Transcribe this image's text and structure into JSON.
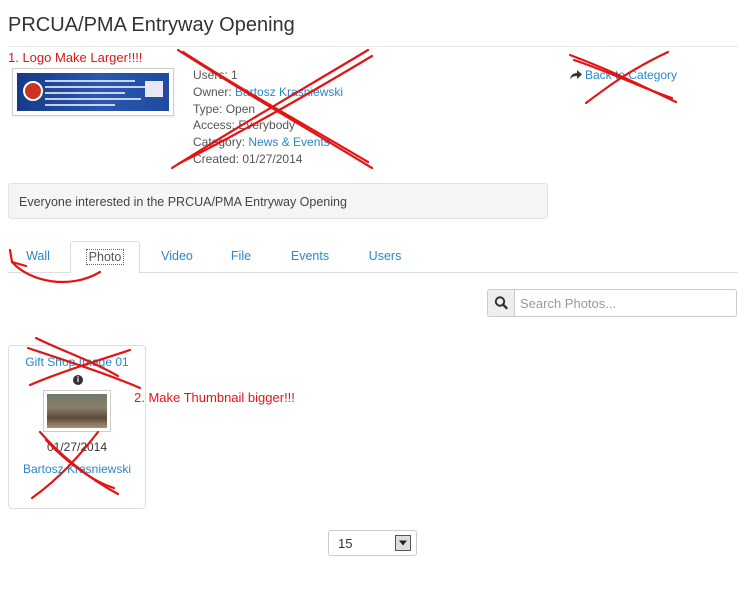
{
  "page": {
    "title": "PRCUA/PMA Entryway Opening"
  },
  "group": {
    "meta": [
      {
        "label": "Users:",
        "value": "1",
        "link": false
      },
      {
        "label": "Owner:",
        "value": "Bartosz Krasniewski",
        "link": true
      },
      {
        "label": "Type:",
        "value": "Open",
        "link": false
      },
      {
        "label": "Access:",
        "value": "Everybody",
        "link": false
      },
      {
        "label": "Category:",
        "value": "News & Events",
        "link": true
      },
      {
        "label": "Created:",
        "value": "01/27/2014",
        "link": false
      }
    ],
    "back_link": "Back to Category",
    "back_icon": "share-arrow-icon",
    "description": "Everyone interested in the PRCUA/PMA Entryway Opening"
  },
  "tabs": [
    {
      "label": "Wall",
      "active": false
    },
    {
      "label": "Photo",
      "active": true
    },
    {
      "label": "Video",
      "active": false
    },
    {
      "label": "File",
      "active": false
    },
    {
      "label": "Events",
      "active": false
    },
    {
      "label": "Users",
      "active": false
    }
  ],
  "search": {
    "placeholder": "Search Photos...",
    "icon": "search-icon"
  },
  "photos": [
    {
      "title": "Gift Shop Image 01",
      "date": "01/27/2014",
      "author": "Bartosz Krasniewski"
    }
  ],
  "pagination": {
    "per_page": "15"
  },
  "annotations": {
    "logo_note": "1. Logo Make Larger!!!!",
    "thumb_note": "2. Make Thumbnail bigger!!!"
  },
  "colors": {
    "link": "#2a87c8",
    "annotation": "#e21414"
  }
}
